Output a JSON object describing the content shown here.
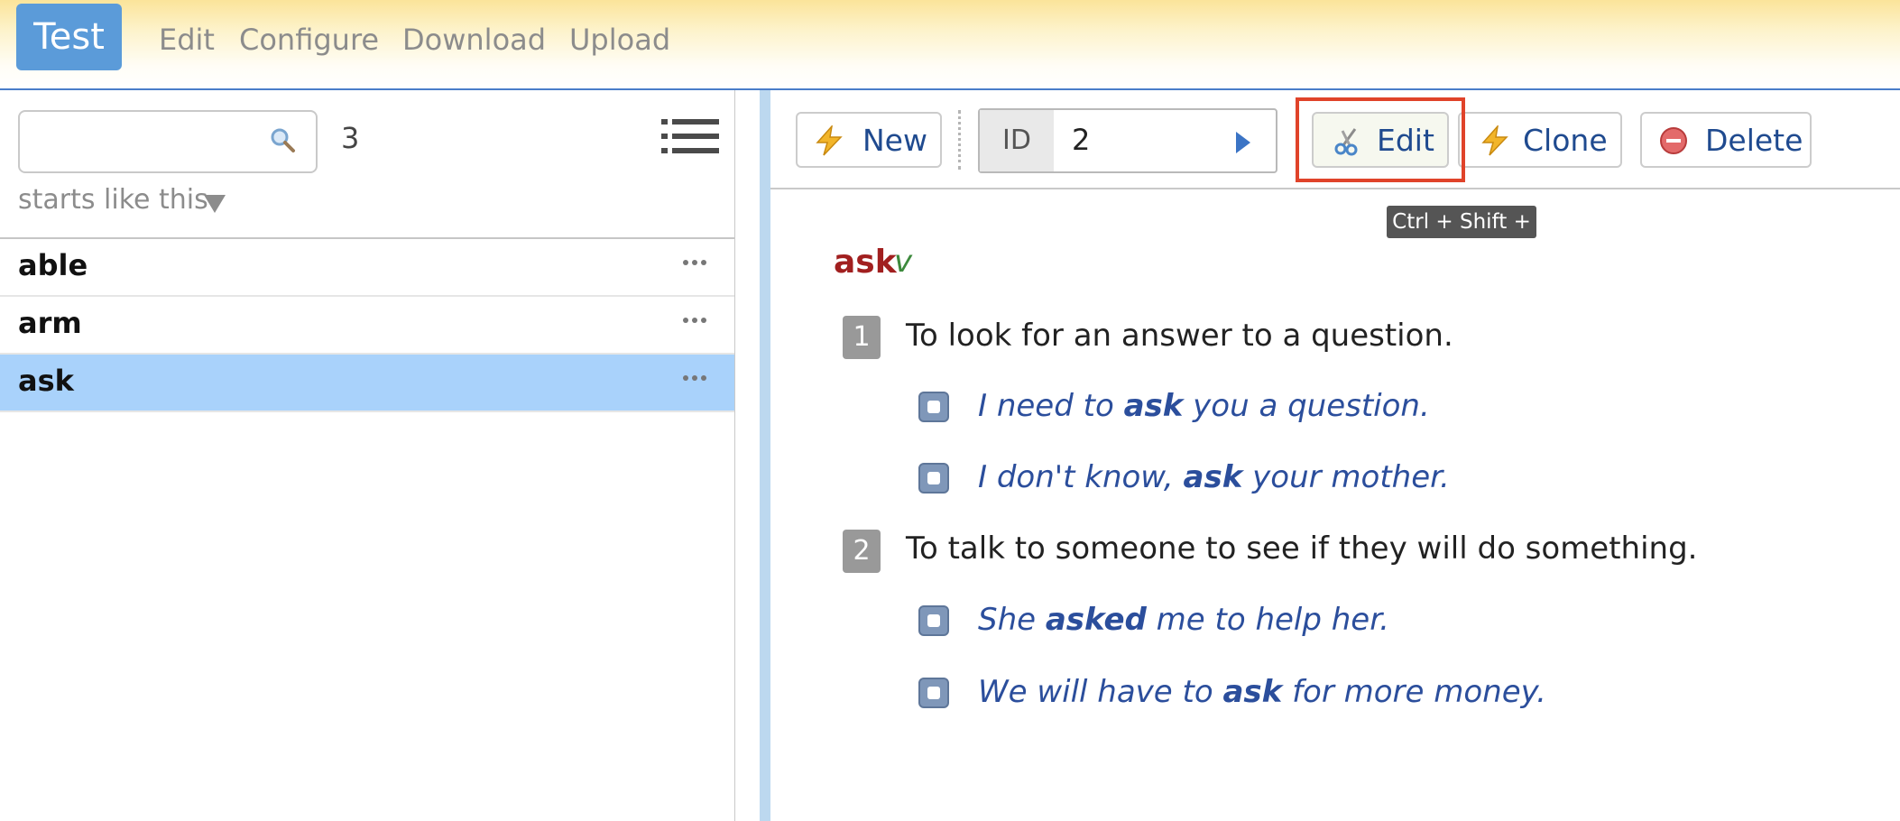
{
  "app": {
    "title": "Test",
    "menu": [
      "Edit",
      "Configure",
      "Download",
      "Upload"
    ]
  },
  "search": {
    "value": "",
    "placeholder": "",
    "result_count": "3",
    "filter_mode": "starts like this"
  },
  "entries": [
    {
      "word": "able",
      "selected": false
    },
    {
      "word": "arm",
      "selected": false
    },
    {
      "word": "ask",
      "selected": true
    }
  ],
  "toolbar": {
    "new_label": "New",
    "id_label": "ID",
    "id_value": "2",
    "edit_label": "Edit",
    "clone_label": "Clone",
    "delete_label": "Delete",
    "edit_tooltip": "Ctrl + Shift + E"
  },
  "entry": {
    "headword": "ask",
    "pos": "v",
    "senses": [
      {
        "number": "1",
        "definition": "To look for an answer to a question.",
        "examples": [
          {
            "before": "I need to ",
            "keyword": "ask",
            "after": " you a question."
          },
          {
            "before": "I don't know, ",
            "keyword": "ask",
            "after": " your mother."
          }
        ]
      },
      {
        "number": "2",
        "definition": "To talk to someone to see if they will do something.",
        "examples": [
          {
            "before": "She ",
            "keyword": "asked",
            "after": " me to help her."
          },
          {
            "before": "We will have to ",
            "keyword": "ask",
            "after": " for more money."
          }
        ]
      }
    ]
  },
  "colors": {
    "accent": "#5b9bd9",
    "highlight_border": "#e0432a",
    "selected_row": "#a9d2fb",
    "headword": "#a11f1f",
    "pos": "#3d8a3d",
    "example": "#2b4e9c"
  }
}
